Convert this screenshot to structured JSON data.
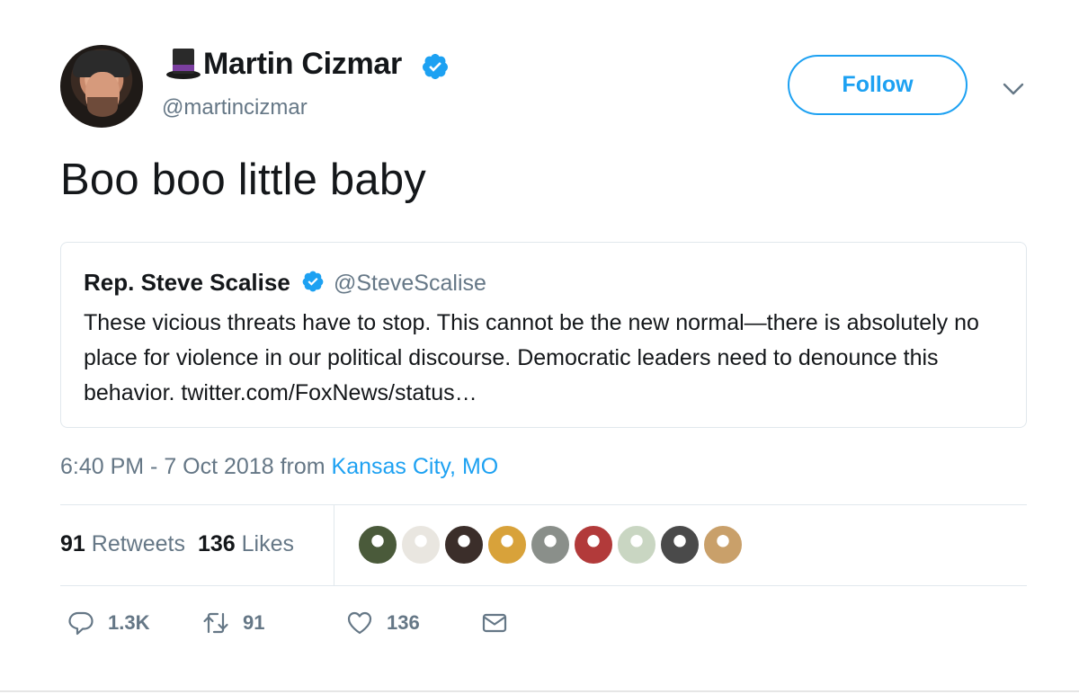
{
  "author": {
    "display_name": "Martin Cizmar",
    "handle": "@martincizmar",
    "emoji_icon": "top-hat-icon",
    "verified": true
  },
  "follow_button": {
    "label": "Follow"
  },
  "menu_icon": "chevron-down-icon",
  "tweet": {
    "text": "Boo boo little baby"
  },
  "quoted_tweet": {
    "name": "Rep. Steve Scalise",
    "handle": "@SteveScalise",
    "verified": true,
    "text": "These vicious threats have to stop. This cannot be the new normal—there is absolutely no place for violence in our political discourse. Democratic leaders need to denounce this behavior. twitter.com/FoxNews/status…"
  },
  "meta": {
    "time": "6:40 PM - 7 Oct 2018",
    "from_label": "from",
    "location": "Kansas City, MO"
  },
  "stats": {
    "retweets_count": "91",
    "retweets_label": "Retweets",
    "likes_count": "136",
    "likes_label": "Likes"
  },
  "likers": [
    {
      "name": "liker-avatar-1",
      "color": "#4a5a3a"
    },
    {
      "name": "liker-avatar-2",
      "color": "#e9e6e0"
    },
    {
      "name": "liker-avatar-3",
      "color": "#3b2e2a"
    },
    {
      "name": "liker-avatar-4",
      "color": "#d8a23a"
    },
    {
      "name": "liker-avatar-5",
      "color": "#8a8f8a"
    },
    {
      "name": "liker-avatar-6",
      "color": "#b23a3a"
    },
    {
      "name": "liker-avatar-7",
      "color": "#c9d6c2"
    },
    {
      "name": "liker-avatar-8",
      "color": "#4a4a4a"
    },
    {
      "name": "liker-avatar-9",
      "color": "#c9a06a"
    }
  ],
  "actions": {
    "reply_count": "1.3K",
    "retweet_count": "91",
    "like_count": "136"
  },
  "colors": {
    "accent": "#1da1f2",
    "secondary_text": "#657786",
    "primary_text": "#14171a",
    "border": "#e1e8ed"
  }
}
